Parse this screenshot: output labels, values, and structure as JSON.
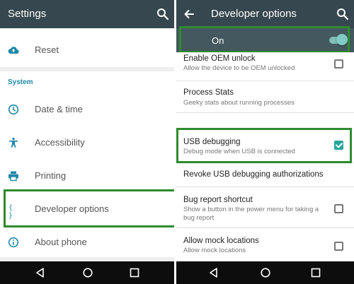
{
  "left": {
    "appbar": {
      "title": "Settings",
      "search_icon": "search-icon"
    },
    "items": [
      {
        "label": "Reset",
        "icon": "cloud-upload-icon"
      },
      {
        "label": "Date & time",
        "icon": "clock-icon"
      },
      {
        "label": "Accessibility",
        "icon": "accessibility-icon"
      },
      {
        "label": "Printing",
        "icon": "printer-icon"
      },
      {
        "label": "Developer options",
        "icon": "braces-icon",
        "icon_text": "{ }"
      },
      {
        "label": "About phone",
        "icon": "info-icon"
      }
    ],
    "section_label": "System"
  },
  "right": {
    "appbar": {
      "title": "Developer options",
      "back_icon": "back-arrow-icon",
      "search_icon": "search-icon"
    },
    "master_switch": {
      "label": "On",
      "state": true
    },
    "items": [
      {
        "title": "Enable OEM unlock",
        "subtitle": "Allow the device to be OEM unlocked",
        "checked": false
      },
      {
        "title": "Process Stats",
        "subtitle": "Geeky stats about running processes"
      },
      {
        "title": "USB debugging",
        "subtitle": "Debug mode when USB is connected",
        "checked": true
      },
      {
        "title": "Revoke USB debugging authorizations"
      },
      {
        "title": "Bug report shortcut",
        "subtitle": "Show a button in the power menu for taking a bug report",
        "checked": false
      },
      {
        "title": "Allow mock locations",
        "subtitle": "Allow mock locations",
        "checked": false
      }
    ]
  },
  "colors": {
    "appbar": "#37474f",
    "accent": "#26a69a",
    "highlight": "#2e8b2e",
    "section": "#1e88a8"
  }
}
